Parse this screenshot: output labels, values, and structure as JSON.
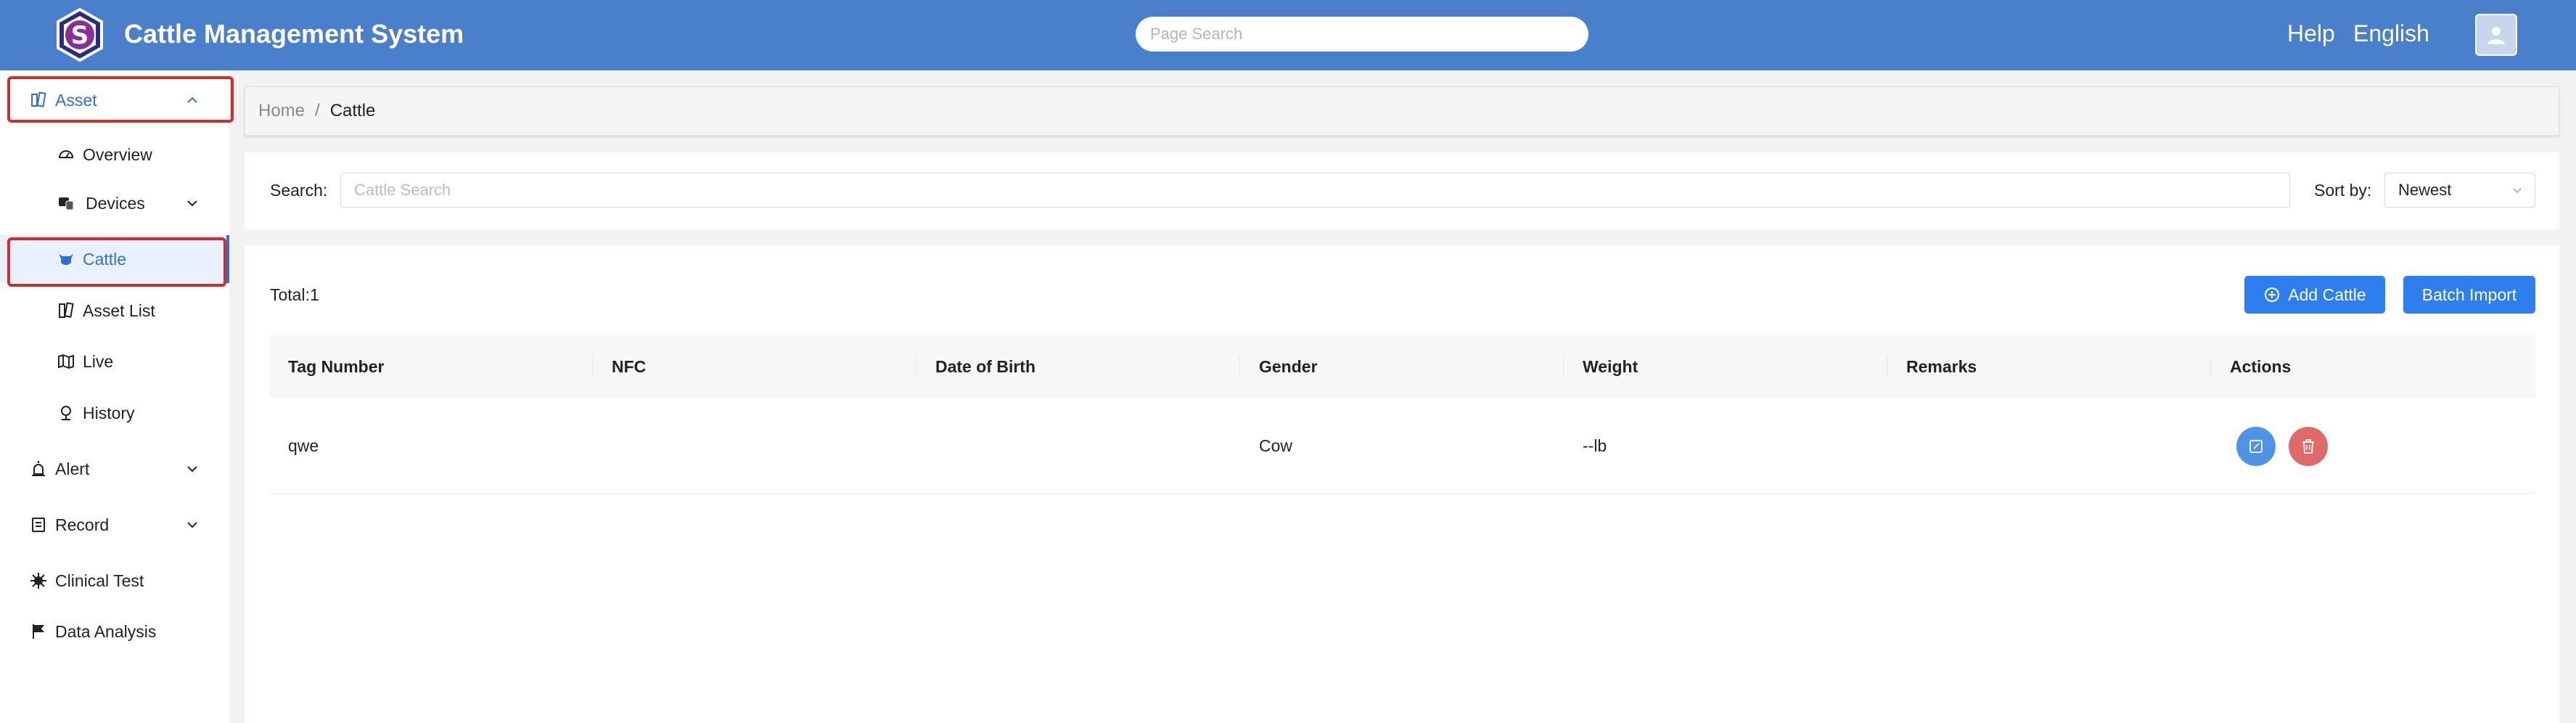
{
  "header": {
    "app_title": "Cattle Management System",
    "search_placeholder": "Page Search",
    "help_label": "Help",
    "language_label": "English",
    "brand_color": "#4a7fcb"
  },
  "sidebar": {
    "asset": {
      "label": "Asset",
      "icon": "asset-icon",
      "expanded": true
    },
    "asset_children": [
      {
        "label": "Overview",
        "icon": "dashboard-icon"
      },
      {
        "label": "Devices",
        "icon": "devices-icon",
        "has_submenu": true
      },
      {
        "label": "Cattle",
        "icon": "cattle-icon",
        "active": true
      },
      {
        "label": "Asset List",
        "icon": "list-icon"
      },
      {
        "label": "Live",
        "icon": "map-icon"
      },
      {
        "label": "History",
        "icon": "history-icon"
      }
    ],
    "alert": {
      "label": "Alert",
      "icon": "alarm-icon"
    },
    "record": {
      "label": "Record",
      "icon": "record-icon"
    },
    "clinical_test": {
      "label": "Clinical Test",
      "icon": "virus-icon"
    },
    "data_analysis": {
      "label": "Data Analysis",
      "icon": "flag-icon"
    },
    "accent_color": "#2f6fd6",
    "highlight_color": "#d62b2b"
  },
  "breadcrumb": {
    "home": "Home",
    "separator": "/",
    "current": "Cattle"
  },
  "filters": {
    "search_label": "Search:",
    "search_placeholder": "Cattle Search",
    "sort_label": "Sort by:",
    "sort_value": "Newest"
  },
  "table_section": {
    "total_label": "Total:1",
    "add_button": "Add Cattle",
    "import_button": "Batch Import",
    "button_color": "#2f7ef0",
    "columns": [
      "Tag Number",
      "NFC",
      "Date of Birth",
      "Gender",
      "Weight",
      "Remarks",
      "Actions"
    ],
    "rows": [
      {
        "tag_number": "qwe",
        "nfc": "",
        "date_of_birth": "",
        "gender": "Cow",
        "weight": "--lb",
        "remarks": ""
      }
    ],
    "edit_color": "#4e93e6",
    "delete_color": "#e06a6a"
  }
}
